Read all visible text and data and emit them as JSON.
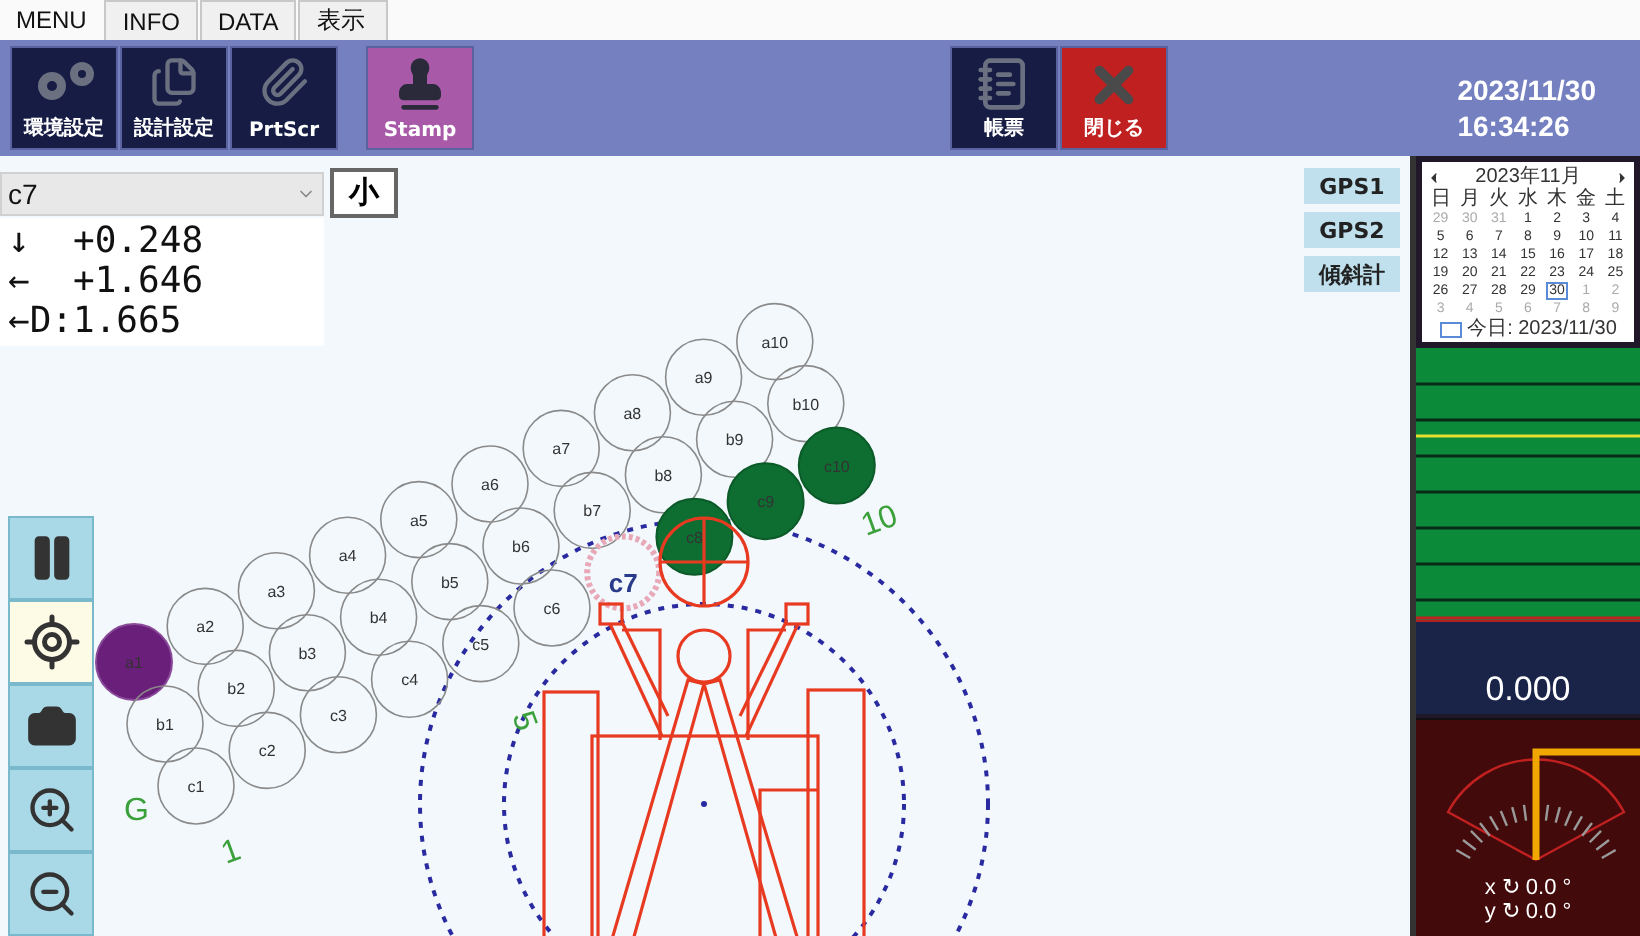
{
  "menu_tabs": [
    {
      "label": "MENU",
      "selected": true
    },
    {
      "label": "INFO",
      "selected": false
    },
    {
      "label": "DATA",
      "selected": false
    },
    {
      "label": "表示",
      "selected": false
    }
  ],
  "toolbar": {
    "groups": [
      {
        "buttons": [
          {
            "label": "環境設定",
            "kind": "settings"
          },
          {
            "label": "設計設定",
            "kind": "design"
          },
          {
            "label": "PrtScr",
            "kind": "print"
          }
        ]
      },
      {
        "buttons": [
          {
            "label": "Stamp",
            "kind": "stamp"
          }
        ]
      },
      {
        "buttons": [
          {
            "label": "帳票",
            "kind": "report"
          },
          {
            "label": "閉じる",
            "kind": "close"
          }
        ]
      }
    ],
    "date": "2023/11/30",
    "time": "16:34:26"
  },
  "selector": {
    "value": "c7"
  },
  "size_button": "小",
  "readouts": [
    {
      "arrow": "↓",
      "value": "+0.248"
    },
    {
      "arrow": "←",
      "value": "+1.646"
    },
    {
      "arrow": "←",
      "value": "D:1.665"
    }
  ],
  "gps_buttons": [
    "GPS1",
    "GPS2",
    "傾斜計"
  ],
  "side_tools": [
    {
      "kind": "pause",
      "selected": false
    },
    {
      "kind": "locate",
      "selected": true
    },
    {
      "kind": "camera",
      "selected": false
    },
    {
      "kind": "zoom_in",
      "selected": false
    },
    {
      "kind": "zoom_out",
      "selected": false
    }
  ],
  "pile_rows": [
    [
      {
        "label": "a1",
        "kind": "origin"
      },
      {
        "label": "a2",
        "kind": "open"
      },
      {
        "label": "a3",
        "kind": "open"
      },
      {
        "label": "a4",
        "kind": "open"
      },
      {
        "label": "a5",
        "kind": "open"
      },
      {
        "label": "a6",
        "kind": "open"
      },
      {
        "label": "a7",
        "kind": "open"
      },
      {
        "label": "a8",
        "kind": "open"
      },
      {
        "label": "a9",
        "kind": "open"
      },
      {
        "label": "a10",
        "kind": "open"
      }
    ],
    [
      {
        "label": "b1",
        "kind": "open"
      },
      {
        "label": "b2",
        "kind": "open"
      },
      {
        "label": "b3",
        "kind": "open"
      },
      {
        "label": "b4",
        "kind": "open"
      },
      {
        "label": "b5",
        "kind": "open"
      },
      {
        "label": "b6",
        "kind": "open"
      },
      {
        "label": "b7",
        "kind": "open"
      },
      {
        "label": "b8",
        "kind": "open"
      },
      {
        "label": "b9",
        "kind": "open"
      },
      {
        "label": "b10",
        "kind": "open"
      }
    ],
    [
      {
        "label": "c1",
        "kind": "open"
      },
      {
        "label": "c2",
        "kind": "open"
      },
      {
        "label": "c3",
        "kind": "open"
      },
      {
        "label": "c4",
        "kind": "open"
      },
      {
        "label": "c5",
        "kind": "open"
      },
      {
        "label": "c6",
        "kind": "open"
      },
      {
        "label": "c7",
        "kind": "current"
      },
      {
        "label": "c8",
        "kind": "done"
      },
      {
        "label": "c9",
        "kind": "done"
      },
      {
        "label": "c10",
        "kind": "done"
      }
    ]
  ],
  "distance_marks": [
    "1",
    "5",
    "10",
    "G"
  ],
  "calendar": {
    "month": "2023年11月",
    "weekdays": [
      "日",
      "月",
      "火",
      "水",
      "木",
      "金",
      "土"
    ],
    "weeks": [
      [
        {
          "day": "29",
          "muted": true,
          "selected": false
        },
        {
          "day": "30",
          "muted": true,
          "selected": false
        },
        {
          "day": "31",
          "muted": true,
          "selected": false
        },
        {
          "day": "1",
          "muted": false,
          "selected": false
        },
        {
          "day": "2",
          "muted": false,
          "selected": false
        },
        {
          "day": "3",
          "muted": false,
          "selected": false
        },
        {
          "day": "4",
          "muted": false,
          "selected": false
        }
      ],
      [
        {
          "day": "5",
          "muted": false,
          "selected": false
        },
        {
          "day": "6",
          "muted": false,
          "selected": false
        },
        {
          "day": "7",
          "muted": false,
          "selected": false
        },
        {
          "day": "8",
          "muted": false,
          "selected": false
        },
        {
          "day": "9",
          "muted": false,
          "selected": false
        },
        {
          "day": "10",
          "muted": false,
          "selected": false
        },
        {
          "day": "11",
          "muted": false,
          "selected": false
        }
      ],
      [
        {
          "day": "12",
          "muted": false,
          "selected": false
        },
        {
          "day": "13",
          "muted": false,
          "selected": false
        },
        {
          "day": "14",
          "muted": false,
          "selected": false
        },
        {
          "day": "15",
          "muted": false,
          "selected": false
        },
        {
          "day": "16",
          "muted": false,
          "selected": false
        },
        {
          "day": "17",
          "muted": false,
          "selected": false
        },
        {
          "day": "18",
          "muted": false,
          "selected": false
        }
      ],
      [
        {
          "day": "19",
          "muted": false,
          "selected": false
        },
        {
          "day": "20",
          "muted": false,
          "selected": false
        },
        {
          "day": "21",
          "muted": false,
          "selected": false
        },
        {
          "day": "22",
          "muted": false,
          "selected": false
        },
        {
          "day": "23",
          "muted": false,
          "selected": false
        },
        {
          "day": "24",
          "muted": false,
          "selected": false
        },
        {
          "day": "25",
          "muted": false,
          "selected": false
        }
      ],
      [
        {
          "day": "26",
          "muted": false,
          "selected": false
        },
        {
          "day": "27",
          "muted": false,
          "selected": false
        },
        {
          "day": "28",
          "muted": false,
          "selected": false
        },
        {
          "day": "29",
          "muted": false,
          "selected": false
        },
        {
          "day": "30",
          "muted": false,
          "selected": true
        },
        {
          "day": "1",
          "muted": true,
          "selected": false
        },
        {
          "day": "2",
          "muted": true,
          "selected": false
        }
      ],
      [
        {
          "day": "3",
          "muted": true,
          "selected": false
        },
        {
          "day": "4",
          "muted": true,
          "selected": false
        },
        {
          "day": "5",
          "muted": true,
          "selected": false
        },
        {
          "day": "6",
          "muted": true,
          "selected": false
        },
        {
          "day": "7",
          "muted": true,
          "selected": false
        },
        {
          "day": "8",
          "muted": true,
          "selected": false
        },
        {
          "day": "9",
          "muted": true,
          "selected": false
        }
      ]
    ],
    "today": "今日: 2023/11/30"
  },
  "level_reading": "0.000",
  "tilt": [
    {
      "axis": "x",
      "symbol": "↻",
      "value": "0.0 °"
    },
    {
      "axis": "y",
      "symbol": "↻",
      "value": "0.0 °"
    }
  ]
}
